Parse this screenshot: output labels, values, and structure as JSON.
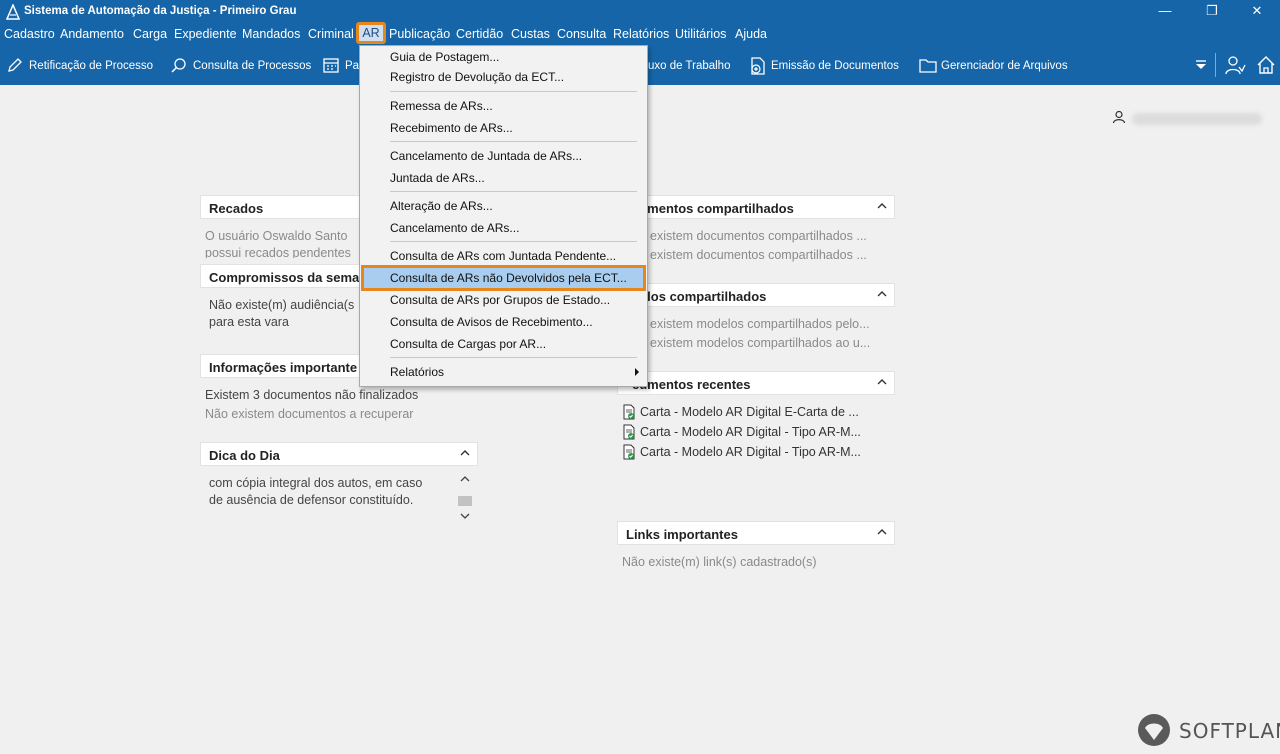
{
  "window": {
    "title": "Sistema de Automação da Justiça - Primeiro Grau",
    "minimize": "—",
    "maximize": "❐",
    "close": "✕"
  },
  "menubar": {
    "items": [
      "Cadastro",
      "Andamento",
      "Carga",
      "Expediente",
      "Mandados",
      "Criminal",
      "AR",
      "Publicação",
      "Certidão",
      "Custas",
      "Consulta",
      "Relatórios",
      "Utilitários",
      "Ajuda"
    ]
  },
  "toolbar": {
    "items": [
      "Retificação de Processo",
      "Consulta de Processos",
      "Pa",
      "uxo de Trabalho",
      "Emissão de Documentos",
      "Gerenciador de Arquivos"
    ]
  },
  "dropdown": {
    "items": [
      "Guia de Postagem...",
      "Registro de Devolução da ECT...",
      "Remessa de ARs...",
      "Recebimento de ARs...",
      "Cancelamento de Juntada de ARs...",
      "Juntada de ARs...",
      "Alteração de ARs...",
      "Cancelamento de ARs...",
      "Consulta de ARs com Juntada Pendente...",
      "Consulta de ARs não Devolvidos pela ECT...",
      "Consulta de ARs por Grupos de Estado...",
      "Consulta de Avisos de Recebimento...",
      "Consulta de Cargas por AR...",
      "Relatórios"
    ],
    "highlighted": "Consulta de ARs não Devolvidos pela ECT...",
    "highlight_color": "#e8861e"
  },
  "panels": {
    "recados": {
      "title": "Recados",
      "lines": [
        "O usuário Oswaldo Santo",
        "possui recados pendentes"
      ]
    },
    "compromissos": {
      "title": "Compromissos da sema",
      "lines": [
        "Não existe(m) audiência(s",
        "para esta vara"
      ]
    },
    "informacoes": {
      "title": "Informações importante",
      "lines": [
        "Existem 3 documentos não finalizados",
        "Não existem documentos a recuperar"
      ]
    },
    "dica": {
      "title": "Dica do Dia",
      "lines": [
        "com cópia integral dos autos, em caso",
        "de ausência de defensor constituído."
      ]
    },
    "documentos_compartilhados": {
      "title": "cumentos compartilhados",
      "lines": [
        "existem documentos compartilhados ...",
        "existem documentos compartilhados ..."
      ]
    },
    "modelos_compartilhados": {
      "title": "delos compartilhados",
      "lines": [
        "existem modelos compartilhados pelo...",
        "existem modelos compartilhados ao u..."
      ]
    },
    "documentos_recentes": {
      "title": "cumentos recentes",
      "items": [
        "Carta - Modelo AR Digital E-Carta de ...",
        "Carta - Modelo AR Digital - Tipo AR-M...",
        "Carta - Modelo AR Digital - Tipo AR-M..."
      ]
    },
    "links": {
      "title": "Links importantes",
      "lines": [
        "Não existe(m) link(s) cadastrado(s)"
      ]
    }
  },
  "brand": {
    "name": "SOFTPLAN"
  },
  "colors": {
    "accent": "#1565a8",
    "highlight": "#e8861e",
    "background": "#f0f0f0"
  }
}
